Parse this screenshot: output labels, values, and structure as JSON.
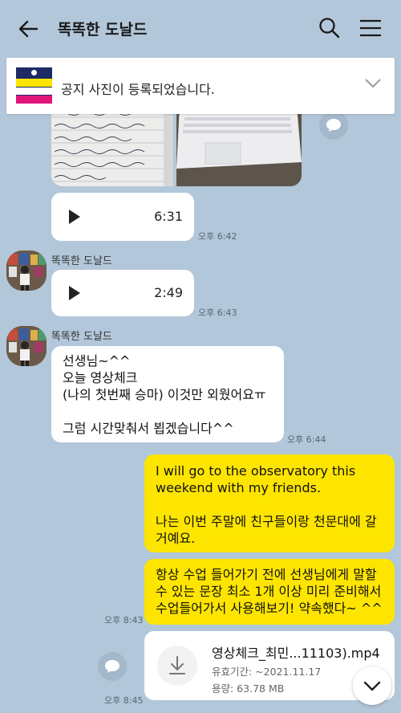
{
  "header": {
    "title": "똑똑한 도날드",
    "back_icon": "arrow-left-icon",
    "search_icon": "search-icon",
    "menu_icon": "hamburger-menu-icon"
  },
  "notice": {
    "text": "공지 사진이 등록되었습니다.",
    "thumb_lines": [
      "원어민 수업",
      "수업 회화책",
      "졸업 / 대고"
    ]
  },
  "messages": {
    "photo_share_icon": "share-bubble-icon",
    "voice1": {
      "duration": "6:31",
      "time": "오후 6:42"
    },
    "voice2": {
      "sender": "똑똑한 도날드",
      "duration": "2:49",
      "time": "오후 6:43"
    },
    "text1": {
      "sender": "똑똑한 도날드",
      "body": "선생님~^^\n오늘 영상체크\n(나의 첫번째 승마) 이것만 외웠어요ㅠ\n\n그럼 시간맞춰서 뵙겠습니다^^",
      "time": "오후 6:44"
    },
    "out1": {
      "body": "I will go to the observatory this weekend with my friends.\n\n나는 이번 주말에 친구들이랑 천문대에 갈거예요."
    },
    "out2": {
      "body": "항상 수업 들어가기 전에 선생님에게 말할 수 있는 문장 최소 1개 이상 미리 준비해서 수업들어가서 사용해보기! 약속했다~ ^^",
      "time": "오후 8:43"
    },
    "file": {
      "name": "영상체크_최민...11103).mp4",
      "expiry": "유효기간: ~2021.11.17",
      "size": "용량: 63.78 MB",
      "time": "오후 8:45"
    }
  },
  "colors": {
    "background": "#b2c7d9",
    "outgoing_bubble": "#fee500",
    "incoming_bubble": "#ffffff"
  }
}
